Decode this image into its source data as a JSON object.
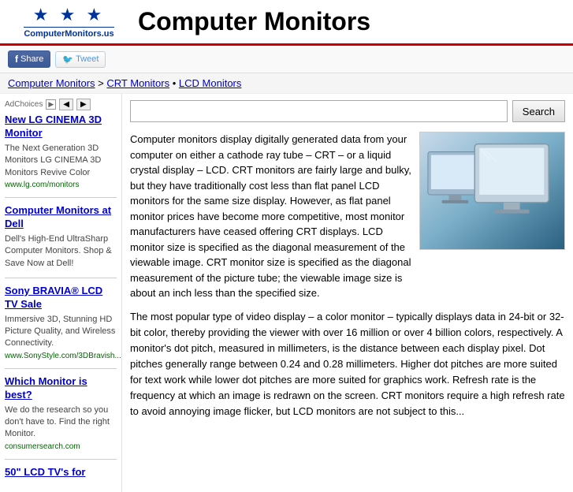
{
  "header": {
    "logo_stars": "★ ★ ★",
    "logo_text": "ComputerMonitors.us",
    "site_title": "Computer Monitors"
  },
  "social": {
    "share_label": "Share",
    "tweet_label": "Tweet"
  },
  "breadcrumb": {
    "home": "Computer Monitors",
    "separator1": " > ",
    "crt": "CRT Monitors",
    "separator2": " • ",
    "lcd": "LCD Monitors"
  },
  "search": {
    "placeholder": "",
    "button_label": "Search"
  },
  "sidebar": {
    "ad_label": "AdChoices",
    "items": [
      {
        "title": "New LG CINEMA 3D Monitor",
        "description": "The Next Generation 3D Monitors LG CINEMA 3D Monitors Revive Color",
        "url": "www.lg.com/monitors"
      },
      {
        "title": "Computer Monitors at Dell",
        "description": "Dell's High-End UltraSharp Computer Monitors. Shop & Save Now at Dell!",
        "url": ""
      },
      {
        "title": "Sony BRAVIA® LCD TV Sale",
        "description": "Immersive 3D, Stunning HD Picture Quality, and Wireless Connectivity.",
        "url": "www.SonyStyle.com/3DBravish..."
      },
      {
        "title": "Which Monitor is best?",
        "description": "We do the research so you don't have to. Find the right Monitor.",
        "url": "consumersearch.com"
      },
      {
        "title": "50\" LCD TV's for",
        "description": "",
        "url": ""
      }
    ]
  },
  "article": {
    "intro": "Computer monitors display digitally generated data from your computer on either a cathode ray tube – CRT – or a liquid crystal display – LCD. CRT monitors are fairly large and bulky, but they have traditionally cost less than flat panel LCD monitors for the same size display.  However, as flat panel monitor prices have become more competitive, most monitor manufacturers have ceased offering CRT displays.  LCD monitor size is specified as the diagonal measurement of the viewable image.  CRT monitor size is specified as the diagonal measurement of the picture tube; the viewable image size is about an inch less than the specified size.",
    "body": "The most popular type of video display – a color monitor – typically displays data in 24-bit or 32-bit color, thereby providing the viewer with over 16 million or over 4 billion colors, respectively.  A monitor's dot pitch, measured in millimeters, is the distance between each display pixel.  Dot pitches generally range between 0.24 and 0.28 millimeters.  Higher dot pitches are more suited for text work while lower dot pitches are more suited for graphics work.  Refresh rate is the frequency at which an image is redrawn on the screen.  CRT monitors require a high refresh rate to avoid annoying image flicker, but LCD monitors are not subject to this..."
  }
}
